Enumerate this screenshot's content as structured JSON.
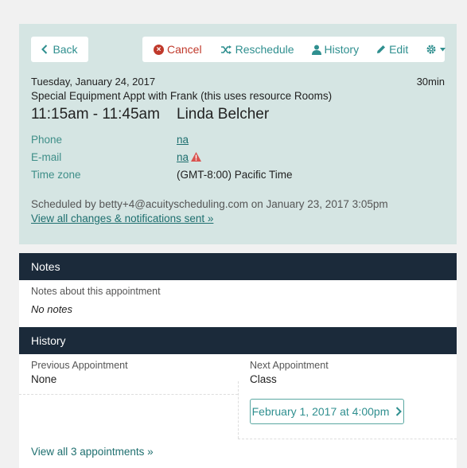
{
  "toolbar": {
    "back": "Back",
    "cancel": "Cancel",
    "reschedule": "Reschedule",
    "history": "History",
    "edit": "Edit"
  },
  "appointment": {
    "date": "Tuesday, January 24, 2017",
    "duration": "30min",
    "type": "Special Equipment Appt with Frank (this uses resource Rooms)",
    "time": "11:15am - 11:45am",
    "client": "Linda Belcher",
    "fields": [
      {
        "label": "Phone",
        "value": "na"
      },
      {
        "label": "E-mail",
        "value": "na"
      },
      {
        "label": "Time zone",
        "value": "(GMT-8:00) Pacific Time"
      }
    ],
    "scheduled_by": "Scheduled by betty+4@acuityscheduling.com on January 23, 2017 3:05pm",
    "view_changes": "View all changes & notifications sent »"
  },
  "notes": {
    "heading": "Notes",
    "label": "Notes about this appointment",
    "value": "No notes"
  },
  "history": {
    "heading": "History",
    "previous_label": "Previous Appointment",
    "previous_value": "None",
    "next_label": "Next Appointment",
    "next_value": "Class",
    "next_button": "February 1, 2017 at 4:00pm",
    "view_all": "View all 3 appointments »"
  },
  "colors": {
    "panel_bg": "#d5e5e3",
    "accent": "#2f8f8f",
    "danger": "#c0392b",
    "header_bg": "#1b2a3a"
  },
  "icons": [
    "chevron-left-icon",
    "cancel-circle-icon",
    "shuffle-icon",
    "user-icon",
    "pencil-icon",
    "gear-icon",
    "warning-icon",
    "chevron-right-icon"
  ]
}
